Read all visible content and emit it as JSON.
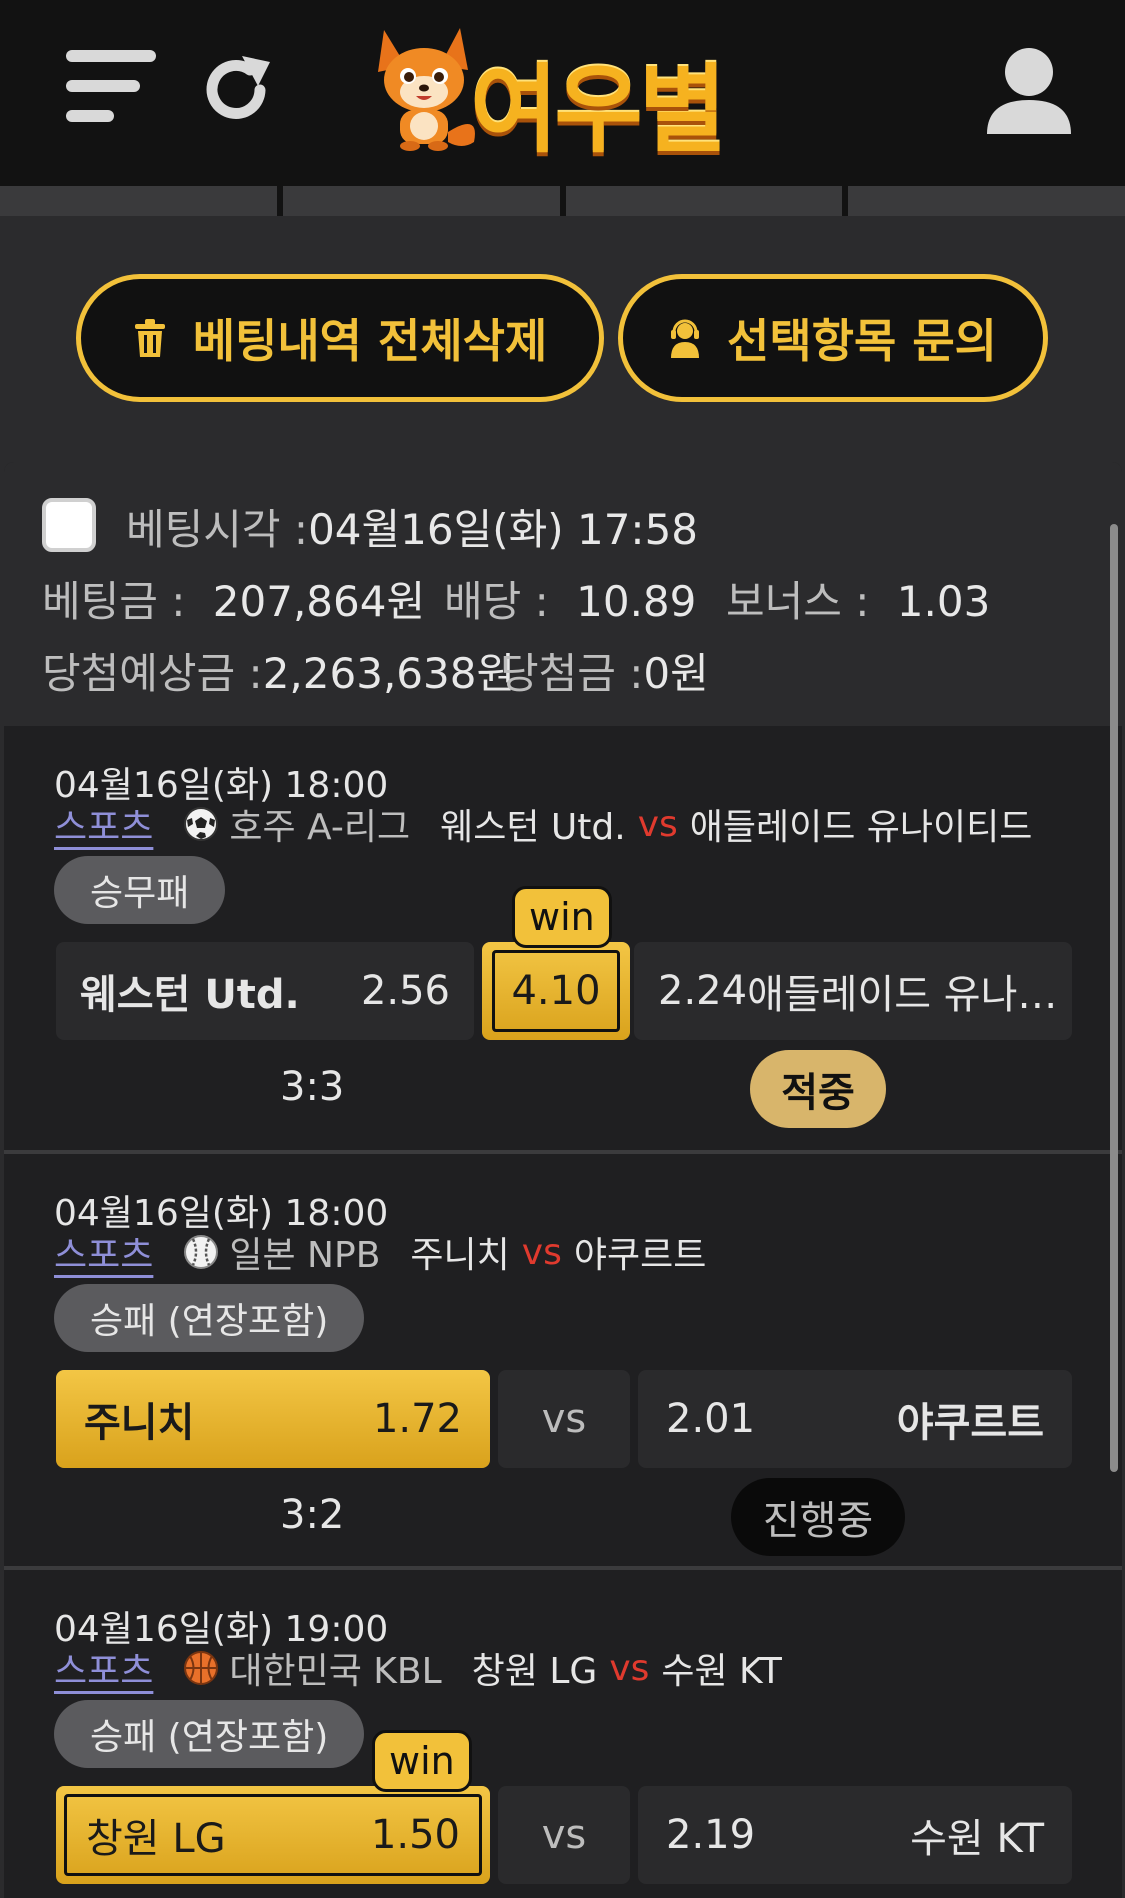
{
  "header": {
    "logo_text": "여우별",
    "icons": [
      "hamburger-menu-icon",
      "refresh-icon",
      "fox-mascot-logo",
      "user-icon"
    ]
  },
  "actions": {
    "delete_all_label": "베팅내역 전체삭제",
    "inquiry_label": "선택항목 문의"
  },
  "bet": {
    "time_label": "베팅시각 :",
    "time_value": "04월16일(화) 17:58",
    "amount_label": "베팅금 :",
    "amount_value": "207,864원",
    "odds_label": "배당 :",
    "odds_value": "10.89",
    "bonus_label": "보너스 :",
    "bonus_value": "1.03",
    "expected_label": "당첨예상금 :",
    "expected_value": "2,263,638원",
    "won_label": "당첨금 :",
    "won_value": "0원"
  },
  "matches": [
    {
      "date": "04월16일(화) 18:00",
      "sport": "스포츠",
      "league": "호주 A-리그",
      "home": "웨스턴 Utd.",
      "vs": "vs",
      "away": "애들레이드 유나이티드",
      "market": "승무패",
      "home_name": "웨스턴 Utd.",
      "home_odds": "2.56",
      "draw_odds": "4.10",
      "away_odds": "2.24",
      "away_name": "애들레이드 유나…",
      "win": "win",
      "score": "3:3",
      "status": "적중"
    },
    {
      "date": "04월16일(화) 18:00",
      "sport": "스포츠",
      "league": "일본 NPB",
      "home": "주니치",
      "vs": "vs",
      "away": "야쿠르트",
      "market": "승패 (연장포함)",
      "home_name": "주니치",
      "home_odds": "1.72",
      "center": "vs",
      "away_odds": "2.01",
      "away_name": "야쿠르트",
      "score": "3:2",
      "status": "진행중"
    },
    {
      "date": "04월16일(화) 19:00",
      "sport": "스포츠",
      "league": "대한민국 KBL",
      "home": "창원 LG",
      "vs": "vs",
      "away": "수원 KT",
      "market": "승패 (연장포함)",
      "home_name": "창원 LG",
      "home_odds": "1.50",
      "center": "vs",
      "away_odds": "2.19",
      "away_name": "수원 KT",
      "win": "win"
    }
  ],
  "colors": {
    "accent_gold": "#f2c13a",
    "vs_red": "#e03a2e",
    "sport_link": "#8f8fd8",
    "hit_badge": "#d8b56b"
  }
}
